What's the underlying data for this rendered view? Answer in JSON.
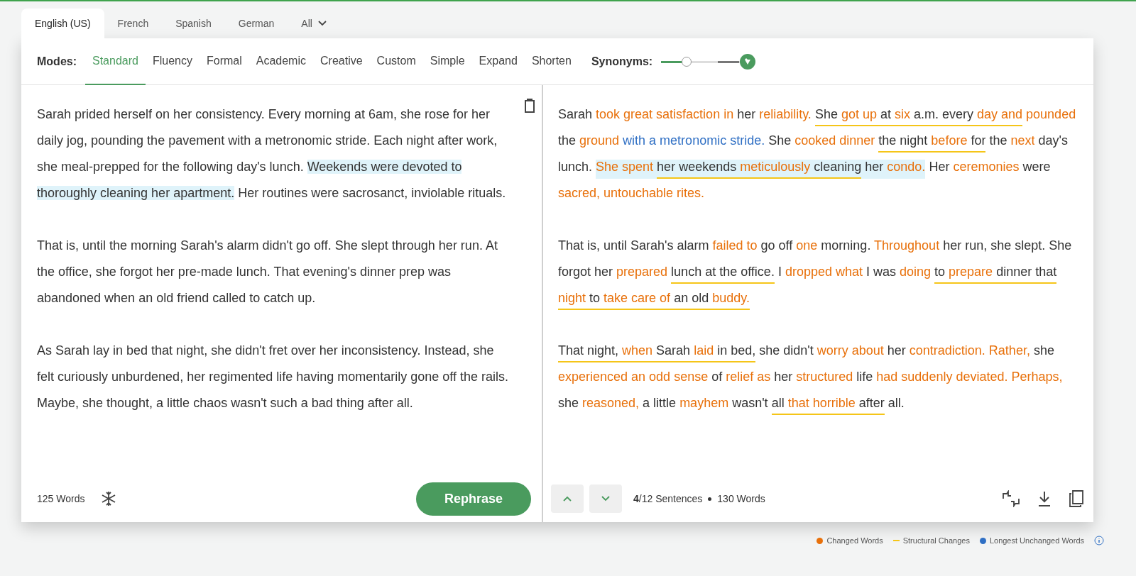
{
  "language_tabs": [
    {
      "label": "English (US)",
      "selected": true
    },
    {
      "label": "French",
      "selected": false
    },
    {
      "label": "Spanish",
      "selected": false
    },
    {
      "label": "German",
      "selected": false
    },
    {
      "label": "All",
      "selected": false,
      "kind": "dropdown"
    }
  ],
  "modes": {
    "label": "Modes:",
    "items": [
      {
        "label": "Standard",
        "selected": true
      },
      {
        "label": "Fluency",
        "selected": false
      },
      {
        "label": "Formal",
        "selected": false
      },
      {
        "label": "Academic",
        "selected": false
      },
      {
        "label": "Creative",
        "selected": false
      },
      {
        "label": "Custom",
        "selected": false
      },
      {
        "label": "Simple",
        "selected": false
      },
      {
        "label": "Expand",
        "selected": false
      },
      {
        "label": "Shorten",
        "selected": false
      }
    ]
  },
  "synonyms": {
    "label": "Synonyms:",
    "level": 0.33
  },
  "input": {
    "paragraphs": [
      [
        {
          "t": "Sarah prided herself on her consistency. Every morning at 6am, she rose for her daily jog, pounding the pavement with a metronomic stride. Each night after work, she meal-prepped for the following day's lunch. ",
          "highlighted": false
        },
        {
          "t": "Weekends were devoted to thoroughly cleaning her apartment.",
          "highlighted": true
        },
        {
          "t": " Her routines were sacrosanct, inviolable rituals.",
          "highlighted": false
        }
      ],
      [
        {
          "t": "That is, until the morning Sarah's alarm didn't go off. She slept through her run. At the office, she forgot her pre-made lunch. That evening's dinner prep was abandoned when an old friend called to catch up.",
          "highlighted": false
        }
      ],
      [
        {
          "t": "As Sarah lay in bed that night, she didn't fret over her inconsistency. Instead, she felt curiously unburdened, her regimented life having momentarily gone off the rails. Maybe, she thought, a little chaos wasn't such a bad thing after all.",
          "highlighted": false
        }
      ]
    ],
    "word_count": "125 Words",
    "button": "Rephrase"
  },
  "output": {
    "paragraphs": [
      [
        {
          "t": "Sarah ",
          "kind": "plain",
          "underlined": false,
          "highlighted": false
        },
        {
          "t": "took great satisfaction in",
          "kind": "changed",
          "underlined": false,
          "highlighted": false
        },
        {
          "t": " her ",
          "kind": "plain",
          "underlined": false,
          "highlighted": false
        },
        {
          "t": "reliability. ",
          "kind": "changed",
          "underlined": false,
          "highlighted": false
        },
        {
          "t": "She ",
          "kind": "plain",
          "underlined": true,
          "highlighted": false
        },
        {
          "t": "got up",
          "kind": "changed",
          "underlined": true,
          "highlighted": false
        },
        {
          "t": " at ",
          "kind": "plain",
          "underlined": true,
          "highlighted": false
        },
        {
          "t": "six",
          "kind": "changed",
          "underlined": true,
          "highlighted": false
        },
        {
          "t": " a.m. every ",
          "kind": "plain",
          "underlined": true,
          "highlighted": false
        },
        {
          "t": "day and",
          "kind": "changed",
          "underlined": true,
          "highlighted": false
        },
        {
          "t": " pounded",
          "kind": "changed",
          "underlined": false,
          "highlighted": false
        },
        {
          "t": " the ",
          "kind": "plain",
          "underlined": false,
          "highlighted": false
        },
        {
          "t": "ground ",
          "kind": "changed",
          "underlined": false,
          "highlighted": false
        },
        {
          "t": "with a metronomic stride.",
          "kind": "longest",
          "underlined": false,
          "highlighted": false
        },
        {
          "t": " She ",
          "kind": "plain",
          "underlined": false,
          "highlighted": false
        },
        {
          "t": "cooked dinner ",
          "kind": "changed",
          "underlined": false,
          "highlighted": false
        },
        {
          "t": "the night ",
          "kind": "plain",
          "underlined": true,
          "highlighted": false
        },
        {
          "t": "before",
          "kind": "changed",
          "underlined": true,
          "highlighted": false
        },
        {
          "t": " for",
          "kind": "plain",
          "underlined": true,
          "highlighted": false
        },
        {
          "t": " the ",
          "kind": "plain",
          "underlined": false,
          "highlighted": false
        },
        {
          "t": "next",
          "kind": "changed",
          "underlined": false,
          "highlighted": false
        },
        {
          "t": " day's lunch. ",
          "kind": "plain",
          "underlined": false,
          "highlighted": false
        },
        {
          "t": "She spent ",
          "kind": "changed",
          "underlined": false,
          "highlighted": true
        },
        {
          "t": "her weekends ",
          "kind": "plain",
          "underlined": true,
          "highlighted": true
        },
        {
          "t": "meticulously",
          "kind": "changed",
          "underlined": true,
          "highlighted": true
        },
        {
          "t": " cleaning",
          "kind": "plain",
          "underlined": true,
          "highlighted": true
        },
        {
          "t": " her ",
          "kind": "plain",
          "underlined": false,
          "highlighted": true
        },
        {
          "t": "condo.",
          "kind": "changed",
          "underlined": false,
          "highlighted": true
        },
        {
          "t": " Her ",
          "kind": "plain",
          "underlined": false,
          "highlighted": false
        },
        {
          "t": "ceremonies",
          "kind": "changed",
          "underlined": false,
          "highlighted": false
        },
        {
          "t": " were ",
          "kind": "plain",
          "underlined": false,
          "highlighted": false
        },
        {
          "t": "sacred, untouchable rites.",
          "kind": "changed",
          "underlined": false,
          "highlighted": false
        }
      ],
      [
        {
          "t": "That is, until Sarah's alarm ",
          "kind": "plain",
          "underlined": false,
          "highlighted": false
        },
        {
          "t": "failed to",
          "kind": "changed",
          "underlined": false,
          "highlighted": false
        },
        {
          "t": " go off ",
          "kind": "plain",
          "underlined": false,
          "highlighted": false
        },
        {
          "t": "one",
          "kind": "changed",
          "underlined": false,
          "highlighted": false
        },
        {
          "t": " morning. ",
          "kind": "plain",
          "underlined": false,
          "highlighted": false
        },
        {
          "t": "Throughout",
          "kind": "changed",
          "underlined": false,
          "highlighted": false
        },
        {
          "t": " her run, she slept. She forgot her ",
          "kind": "plain",
          "underlined": false,
          "highlighted": false
        },
        {
          "t": "prepared ",
          "kind": "changed",
          "underlined": false,
          "highlighted": false
        },
        {
          "t": "lunch at the office.",
          "kind": "plain",
          "underlined": true,
          "highlighted": false
        },
        {
          "t": " I ",
          "kind": "plain",
          "underlined": false,
          "highlighted": false
        },
        {
          "t": "dropped what",
          "kind": "changed",
          "underlined": false,
          "highlighted": false
        },
        {
          "t": " I was ",
          "kind": "plain",
          "underlined": false,
          "highlighted": false
        },
        {
          "t": "doing ",
          "kind": "changed",
          "underlined": false,
          "highlighted": false
        },
        {
          "t": "to",
          "kind": "plain",
          "underlined": true,
          "highlighted": false
        },
        {
          "t": " prepare",
          "kind": "changed",
          "underlined": true,
          "highlighted": false
        },
        {
          "t": " dinner that ",
          "kind": "plain",
          "underlined": true,
          "highlighted": false
        },
        {
          "t": "night",
          "kind": "changed",
          "underlined": true,
          "highlighted": false
        },
        {
          "t": " to ",
          "kind": "plain",
          "underlined": true,
          "highlighted": false
        },
        {
          "t": "take care of",
          "kind": "changed",
          "underlined": true,
          "highlighted": false
        },
        {
          "t": " an old ",
          "kind": "plain",
          "underlined": true,
          "highlighted": false
        },
        {
          "t": "buddy.",
          "kind": "changed",
          "underlined": true,
          "highlighted": false
        }
      ],
      [
        {
          "t": "That night, ",
          "kind": "plain",
          "underlined": true,
          "highlighted": false
        },
        {
          "t": "when",
          "kind": "changed",
          "underlined": true,
          "highlighted": false
        },
        {
          "t": " Sarah ",
          "kind": "plain",
          "underlined": true,
          "highlighted": false
        },
        {
          "t": "laid",
          "kind": "changed",
          "underlined": true,
          "highlighted": false
        },
        {
          "t": " in bed,",
          "kind": "plain",
          "underlined": true,
          "highlighted": false
        },
        {
          "t": " she didn't ",
          "kind": "plain",
          "underlined": false,
          "highlighted": false
        },
        {
          "t": "worry about",
          "kind": "changed",
          "underlined": false,
          "highlighted": false
        },
        {
          "t": " her ",
          "kind": "plain",
          "underlined": false,
          "highlighted": false
        },
        {
          "t": "contradiction. Rather,",
          "kind": "changed",
          "underlined": false,
          "highlighted": false
        },
        {
          "t": " she ",
          "kind": "plain",
          "underlined": false,
          "highlighted": false
        },
        {
          "t": "experienced an odd sense",
          "kind": "changed",
          "underlined": false,
          "highlighted": false
        },
        {
          "t": " of ",
          "kind": "plain",
          "underlined": false,
          "highlighted": false
        },
        {
          "t": "relief as",
          "kind": "changed",
          "underlined": false,
          "highlighted": false
        },
        {
          "t": " her ",
          "kind": "plain",
          "underlined": false,
          "highlighted": false
        },
        {
          "t": "structured",
          "kind": "changed",
          "underlined": false,
          "highlighted": false
        },
        {
          "t": " life ",
          "kind": "plain",
          "underlined": false,
          "highlighted": false
        },
        {
          "t": "had suddenly deviated. Perhaps,",
          "kind": "changed",
          "underlined": false,
          "highlighted": false
        },
        {
          "t": " she ",
          "kind": "plain",
          "underlined": false,
          "highlighted": false
        },
        {
          "t": "reasoned,",
          "kind": "changed",
          "underlined": false,
          "highlighted": false
        },
        {
          "t": " a little ",
          "kind": "plain",
          "underlined": false,
          "highlighted": false
        },
        {
          "t": "mayhem",
          "kind": "changed",
          "underlined": false,
          "highlighted": false
        },
        {
          "t": " wasn't ",
          "kind": "plain",
          "underlined": false,
          "highlighted": false
        },
        {
          "t": "all ",
          "kind": "plain",
          "underlined": true,
          "highlighted": false
        },
        {
          "t": "that horrible",
          "kind": "changed",
          "underlined": true,
          "highlighted": false
        },
        {
          "t": " after",
          "kind": "plain",
          "underlined": true,
          "highlighted": false
        },
        {
          "t": " all.",
          "kind": "plain",
          "underlined": false,
          "highlighted": false
        }
      ]
    ],
    "sentence_status": "**4**/12 Sentences",
    "word_count": "130 Words"
  },
  "legend": [
    {
      "label": "Changed Words",
      "kind": "dot",
      "color": "#e8700a"
    },
    {
      "label": "Structural Changes",
      "kind": "line",
      "color": "#f5c518"
    },
    {
      "label": "Longest Unchanged Words",
      "kind": "dot",
      "color": "#2f6fc4"
    }
  ]
}
